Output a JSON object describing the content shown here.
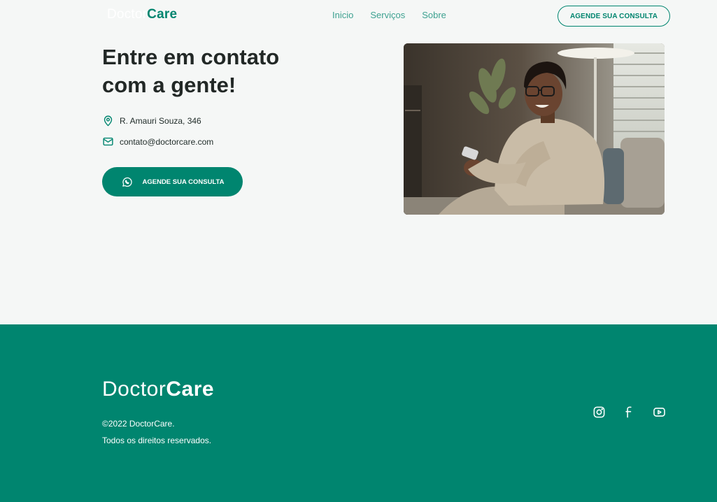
{
  "header": {
    "logo": {
      "part1": "Doctor",
      "part2": "Care"
    },
    "nav": [
      "Inicio",
      "Serviços",
      "Sobre"
    ],
    "cta_label": "AGENDE SUA CONSULTA"
  },
  "contact": {
    "title": "Entre em contato com a gente!",
    "address": "R. Amauri Souza, 346",
    "email": "contato@doctorcare.com",
    "cta_label": "AGENDE SUA CONSULTA",
    "address_icon": "map-pin-icon",
    "email_icon": "mail-icon",
    "cta_icon": "whatsapp-icon"
  },
  "footer": {
    "logo": {
      "part1": "Doctor",
      "part2": "Care"
    },
    "copyright": "©2022 DoctorCare.",
    "rights": "Todos os direitos reservados.",
    "social_icons": [
      "instagram-icon",
      "facebook-icon",
      "youtube-icon"
    ]
  },
  "colors": {
    "brand": "#00856f",
    "background": "#f5f7f6",
    "text": "#1e2a27"
  }
}
